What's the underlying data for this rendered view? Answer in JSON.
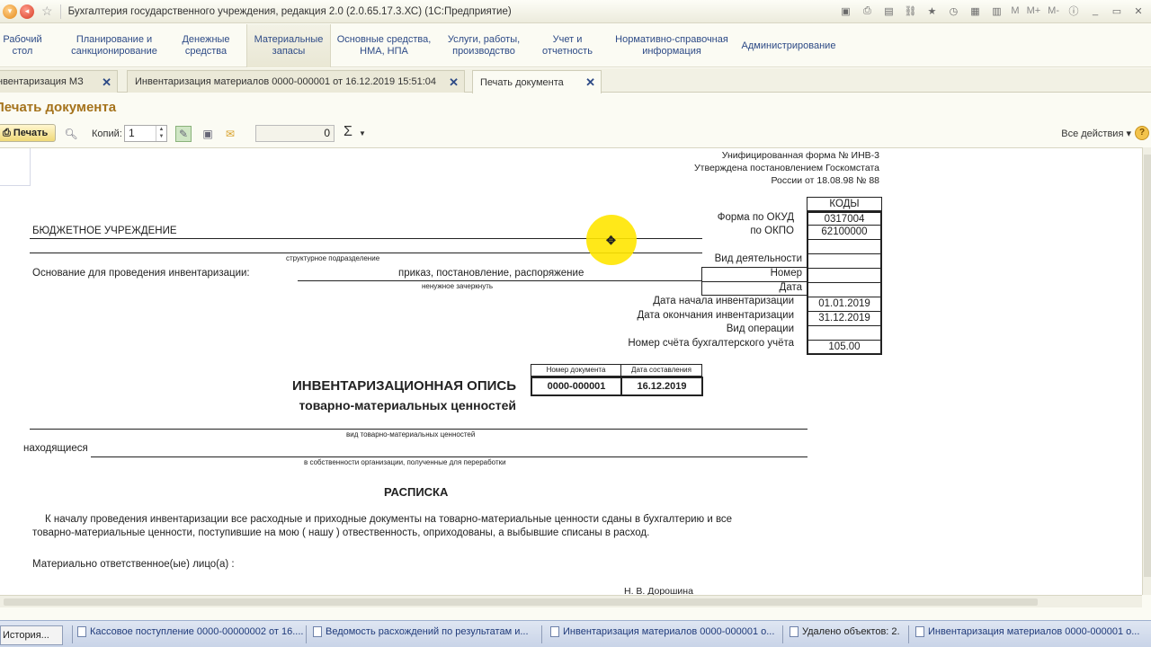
{
  "window": {
    "title": "Бухгалтерия государственного учреждения, редакция 2.0 (2.0.65.17.3.ХС)  (1С:Предприятие)",
    "right_labels": [
      "M",
      "M+",
      "M-"
    ]
  },
  "sections": [
    {
      "label": "Рабочий стол"
    },
    {
      "label": "Планирование и санкционирование"
    },
    {
      "label": "Денежные средства"
    },
    {
      "label": "Материальные запасы"
    },
    {
      "label": "Основные средства, НМА, НПА"
    },
    {
      "label": "Услуги, работы, производство"
    },
    {
      "label": "Учет и отчетность"
    },
    {
      "label": "Нормативно-справочная информация"
    },
    {
      "label": "Администрирование"
    }
  ],
  "tabs": [
    {
      "label": "нвентаризация МЗ"
    },
    {
      "label": "Инвентаризация материалов 0000-000001 от 16.12.2019 15:51:04"
    },
    {
      "label": "Печать документа"
    }
  ],
  "page_title": "Печать документа",
  "toolbar": {
    "print_label": "Печать",
    "copies_label": "Копий:",
    "copies_value": "1",
    "sum_value": "0",
    "sigma": "Σ",
    "all_actions": "Все действия"
  },
  "document": {
    "form_line1": "Унифицированная форма № ИНВ-3",
    "form_line2": "Утверждена постановлением Госкомстата",
    "form_line3": "России от 18.08.98 № 88",
    "codes_header": "КОДЫ",
    "okud_label": "Форма  по ОКУД",
    "okud_value": "0317004",
    "okpo_label": "по ОКПО",
    "okpo_value": "62100000",
    "organization": "БЮДЖЕТНОЕ УЧРЕЖДЕНИЕ",
    "struct_division": "структурное подразделение",
    "activity_label": "Вид деятельности",
    "basis_label": "Основание для проведения инвентаризации:",
    "basis_value": "приказ,  постановление,  распоряжение",
    "number_label": "Номер",
    "date_label": "Дата",
    "cross_out": "ненужное зачеркнуть",
    "start_label": "Дата начала инвентаризации",
    "start_value": "01.01.2019",
    "end_label": "Дата окончания инвентаризации",
    "end_value": "31.12.2019",
    "operation_label": "Вид операции",
    "account_label": "Номер счёта бухгалтерского учёта",
    "account_value": "105.00",
    "docnum_header": "Номер документа",
    "docdate_header": "Дата составления",
    "docnum_value": "0000-000001",
    "docdate_value": "16.12.2019",
    "title1": "ИНВЕНТАРИЗАЦИОННАЯ ОПИСЬ",
    "title2": "товарно-материальных ценностей",
    "kind_caption": "вид товарно-материальных ценностей",
    "located_label": "находящиеся",
    "ownership_caption": "в собственности организации, полученные для переработки",
    "receipt_title": "РАСПИСКА",
    "receipt_line1": "К началу проведения инвентаризации все расходные и приходные документы на товарно-материальные ценности сданы в бухгалтерию и все",
    "receipt_line2": "товарно-материальные ценности, поступившие на мою ( нашу ) отвественность, оприходованы, а выбывшие списаны в расход.",
    "responsible_label": "Материально ответственное(ые) лицо(а) :",
    "responsible_name": "Н. В. Дорошина"
  },
  "taskbar": {
    "history": "История...",
    "items": [
      "Кассовое поступление 0000-00000002 от 16....",
      "Ведомость расхождений по результатам и...",
      "Инвентаризация материалов 0000-000001 о...",
      "Удалено объектов: 2.",
      "Инвентаризация материалов 0000-000001 о..."
    ]
  }
}
